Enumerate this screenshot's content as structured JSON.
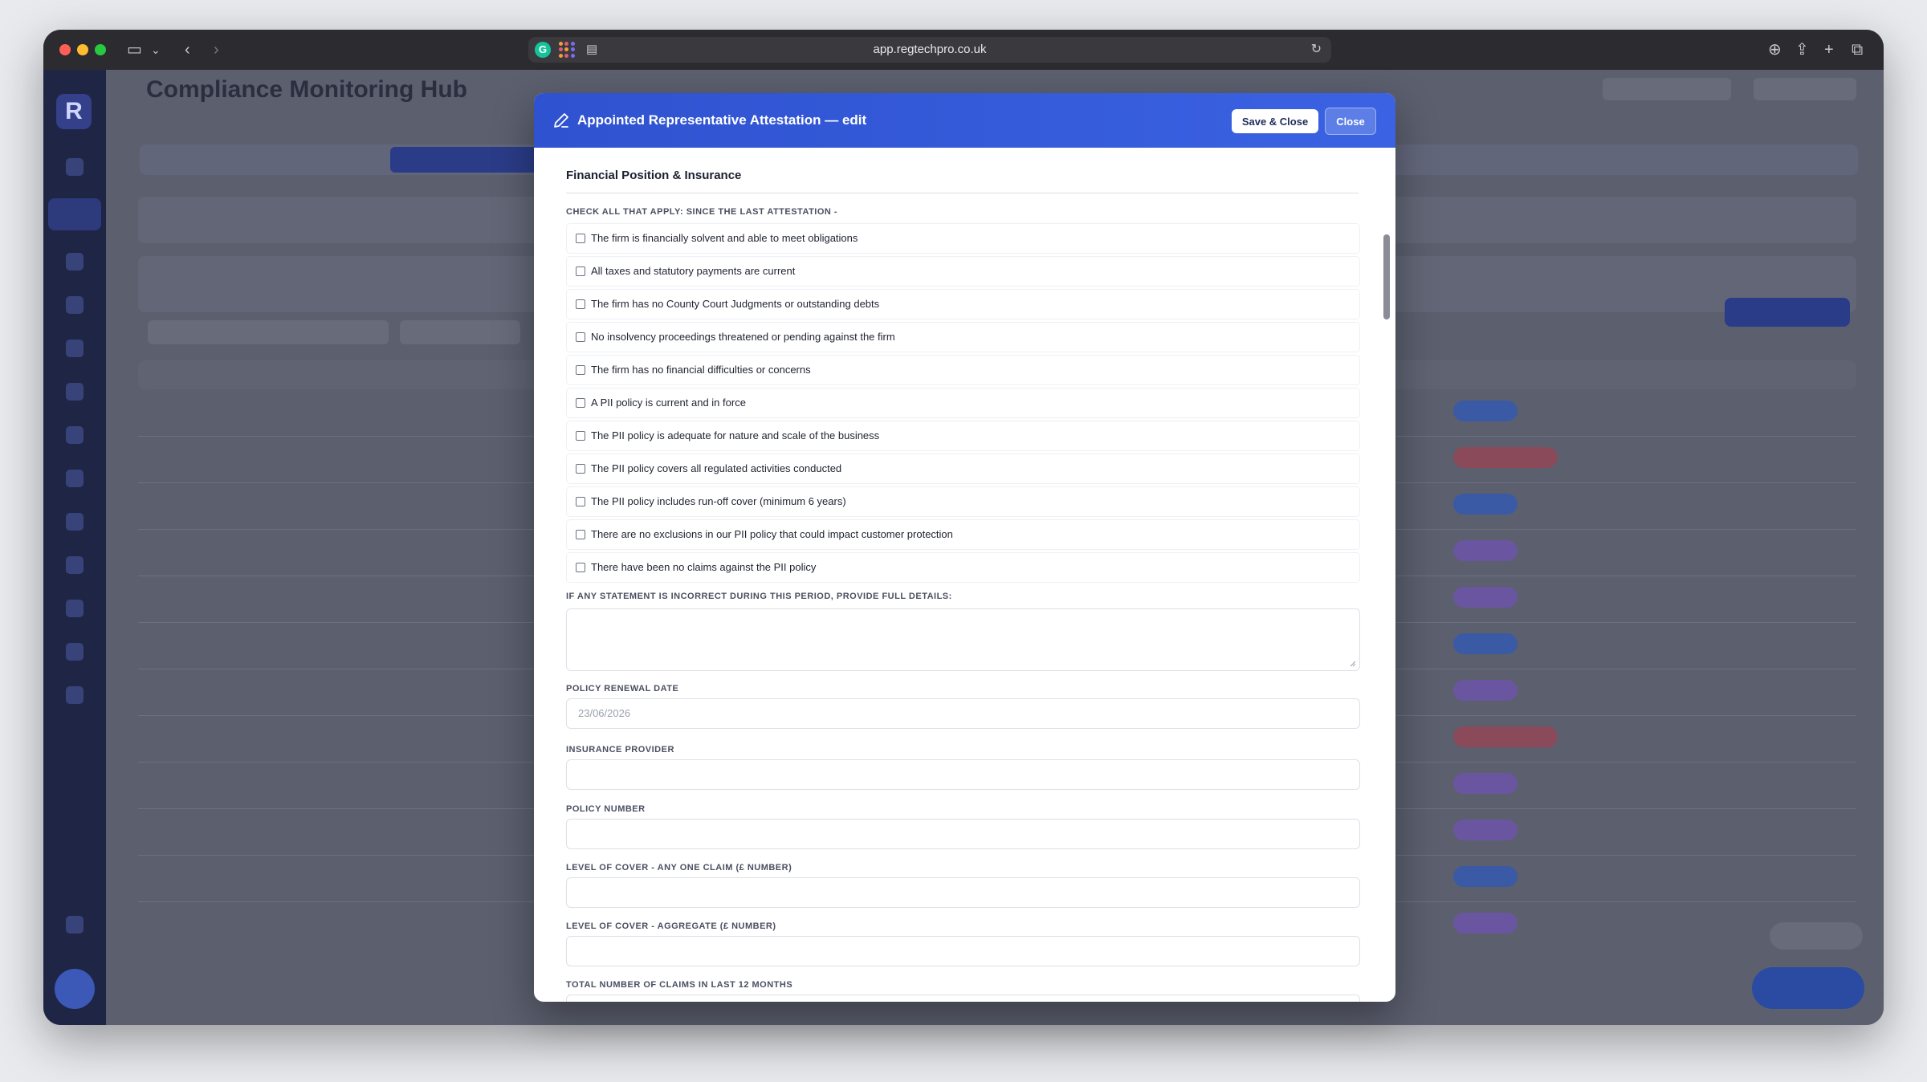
{
  "browser": {
    "url": "app.regtechpro.co.uk"
  },
  "background": {
    "page_title": "Compliance Monitoring Hub"
  },
  "modal": {
    "title": "Appointed Representative Attestation — edit",
    "save_label": "Save & Close",
    "close_label": "Close",
    "section_title": "Financial Position & Insurance",
    "checklist_label": "CHECK ALL THAT APPLY: SINCE THE LAST ATTESTATION -",
    "checklist": [
      "The firm is financially solvent and able to meet obligations",
      "All taxes and statutory payments are current",
      "The firm has no County Court Judgments or outstanding debts",
      "No insolvency proceedings threatened or pending against the firm",
      "The firm has no financial difficulties or concerns",
      "A PII policy is current and in force",
      "The PII policy is adequate for nature and scale of the business",
      "The PII policy covers all regulated activities conducted",
      "The PII policy includes run-off cover (minimum 6 years)",
      "There are no exclusions in our PII policy that could impact customer protection",
      "There have been no claims against the PII policy"
    ],
    "details_label": "IF ANY STATEMENT IS INCORRECT DURING THIS PERIOD, PROVIDE FULL DETAILS:",
    "renewal_label": "POLICY RENEWAL DATE",
    "renewal_value": "23/06/2026",
    "provider_label": "INSURANCE PROVIDER",
    "policy_number_label": "POLICY NUMBER",
    "cover_one_label": "LEVEL OF COVER - ANY ONE CLAIM (£ NUMBER)",
    "cover_aggregate_label": "LEVEL OF COVER - AGGREGATE (£ NUMBER)",
    "claims_label": "TOTAL NUMBER OF CLAIMS IN LAST 12 MONTHS"
  }
}
